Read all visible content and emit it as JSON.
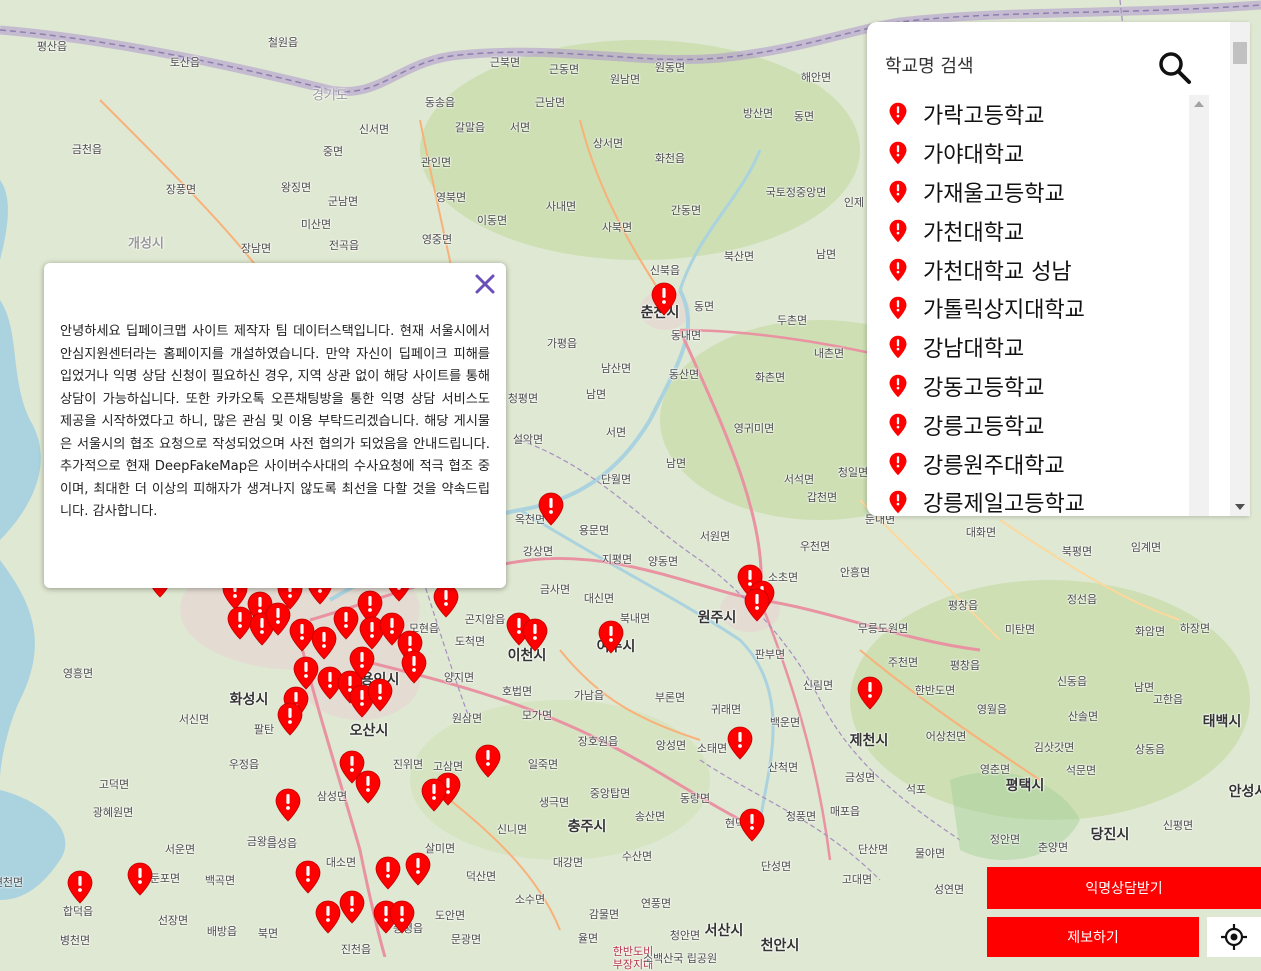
{
  "map": {
    "places": [
      {
        "name": "평산읍"
      },
      {
        "name": "토산읍"
      },
      {
        "name": "철원읍"
      },
      {
        "name": "근북면"
      },
      {
        "name": "근동면"
      },
      {
        "name": "원남면"
      },
      {
        "name": "원동면"
      },
      {
        "name": "해안면"
      },
      {
        "name": "동송읍"
      },
      {
        "name": "근남면"
      },
      {
        "name": "갈말읍"
      },
      {
        "name": "서면"
      },
      {
        "name": "방산면"
      },
      {
        "name": "동면"
      },
      {
        "name": "신서면"
      },
      {
        "name": "중면"
      },
      {
        "name": "상서면"
      },
      {
        "name": "금천읍"
      },
      {
        "name": "관인면"
      },
      {
        "name": "화천읍"
      },
      {
        "name": "왕징면"
      },
      {
        "name": "장풍면"
      },
      {
        "name": "영북면"
      },
      {
        "name": "군남면"
      },
      {
        "name": "국토정중앙면"
      },
      {
        "name": "인제"
      },
      {
        "name": "사내면"
      },
      {
        "name": "간동면"
      },
      {
        "name": "이동면"
      },
      {
        "name": "미산면"
      },
      {
        "name": "사북면"
      },
      {
        "name": "개성시"
      },
      {
        "name": "장남면"
      },
      {
        "name": "전곡읍"
      },
      {
        "name": "영중면"
      },
      {
        "name": "북산면"
      },
      {
        "name": "남면"
      },
      {
        "name": "신북읍"
      },
      {
        "name": "춘천시"
      },
      {
        "name": "동면"
      },
      {
        "name": "두촌면"
      },
      {
        "name": "동내면"
      },
      {
        "name": "가평읍"
      },
      {
        "name": "내촌면"
      },
      {
        "name": "남산면"
      },
      {
        "name": "동산면"
      },
      {
        "name": "화촌면"
      },
      {
        "name": "청평면"
      },
      {
        "name": "남면"
      },
      {
        "name": "설악면"
      },
      {
        "name": "서면"
      },
      {
        "name": "영귀미면"
      },
      {
        "name": "남면"
      },
      {
        "name": "단월면"
      },
      {
        "name": "서석면"
      },
      {
        "name": "청일면"
      },
      {
        "name": "갑천면"
      },
      {
        "name": "옥천면"
      },
      {
        "name": "용문면"
      },
      {
        "name": "강상면"
      },
      {
        "name": "지평면"
      },
      {
        "name": "양동면"
      },
      {
        "name": "서원면"
      },
      {
        "name": "우천면"
      },
      {
        "name": "안흥면"
      },
      {
        "name": "둔내면"
      },
      {
        "name": "대화면"
      },
      {
        "name": "북평면"
      },
      {
        "name": "임계면"
      },
      {
        "name": "금사면"
      },
      {
        "name": "대신면"
      },
      {
        "name": "소초면"
      },
      {
        "name": "평창읍"
      },
      {
        "name": "정선읍"
      },
      {
        "name": "곤지암읍"
      },
      {
        "name": "모현읍"
      },
      {
        "name": "북내면"
      },
      {
        "name": "원주시"
      },
      {
        "name": "무릉도원면"
      },
      {
        "name": "미탄면"
      },
      {
        "name": "화암면"
      },
      {
        "name": "하장면"
      },
      {
        "name": "도척면"
      },
      {
        "name": "이천시"
      },
      {
        "name": "여주시"
      },
      {
        "name": "판부면"
      },
      {
        "name": "주천면"
      },
      {
        "name": "평창읍"
      },
      {
        "name": "영흥면"
      },
      {
        "name": "용인시"
      },
      {
        "name": "양지면"
      },
      {
        "name": "호법면"
      },
      {
        "name": "가남읍"
      },
      {
        "name": "부론면"
      },
      {
        "name": "신림면"
      },
      {
        "name": "한반도면"
      },
      {
        "name": "신동읍"
      },
      {
        "name": "남면"
      },
      {
        "name": "고한읍"
      },
      {
        "name": "화성시"
      },
      {
        "name": "서신면"
      },
      {
        "name": "원삼면"
      },
      {
        "name": "모가면"
      },
      {
        "name": "귀래면"
      },
      {
        "name": "백운면"
      },
      {
        "name": "영월읍"
      },
      {
        "name": "산솔면"
      },
      {
        "name": "태백시"
      },
      {
        "name": "팔탄"
      },
      {
        "name": "오산시"
      },
      {
        "name": "장호원읍"
      },
      {
        "name": "앙성면"
      },
      {
        "name": "소태면"
      },
      {
        "name": "제천시"
      },
      {
        "name": "어상천면"
      },
      {
        "name": "김삿갓면"
      },
      {
        "name": "상동읍"
      },
      {
        "name": "우정읍"
      },
      {
        "name": "진위면"
      },
      {
        "name": "고삼면"
      },
      {
        "name": "일죽면"
      },
      {
        "name": "산척면"
      },
      {
        "name": "금성면"
      },
      {
        "name": "영춘면"
      },
      {
        "name": "석문면"
      },
      {
        "name": "고덕면"
      },
      {
        "name": "삼성면"
      },
      {
        "name": "생극면"
      },
      {
        "name": "중앙탑면"
      },
      {
        "name": "동량면"
      },
      {
        "name": "청풍면"
      },
      {
        "name": "매포읍"
      },
      {
        "name": "석포"
      },
      {
        "name": "평택시"
      },
      {
        "name": "안성시"
      },
      {
        "name": "광혜원면"
      },
      {
        "name": "금왕읍"
      },
      {
        "name": "신니면"
      },
      {
        "name": "충주시"
      },
      {
        "name": "송산면"
      },
      {
        "name": "현덕면"
      },
      {
        "name": "서운면"
      },
      {
        "name": "음성읍"
      },
      {
        "name": "살미면"
      },
      {
        "name": "수산면"
      },
      {
        "name": "단성면"
      },
      {
        "name": "단산면"
      },
      {
        "name": "물야면"
      },
      {
        "name": "춘양면"
      },
      {
        "name": "당진시"
      },
      {
        "name": "신평면"
      },
      {
        "name": "둔포면"
      },
      {
        "name": "백곡면"
      },
      {
        "name": "대소면"
      },
      {
        "name": "덕산면"
      },
      {
        "name": "대강면"
      },
      {
        "name": "고대면"
      },
      {
        "name": "성연면"
      },
      {
        "name": "면천면"
      },
      {
        "name": "합덕읍"
      },
      {
        "name": "선장면"
      },
      {
        "name": "배방읍"
      },
      {
        "name": "북면"
      },
      {
        "name": "진천읍"
      },
      {
        "name": "도안면"
      },
      {
        "name": "소수면"
      },
      {
        "name": "감물면"
      },
      {
        "name": "연풍면"
      },
      {
        "name": "서산시"
      },
      {
        "name": "천안시"
      },
      {
        "name": "병천면"
      },
      {
        "name": "증평읍"
      },
      {
        "name": "문광면"
      },
      {
        "name": "율면"
      },
      {
        "name": "청안면"
      },
      {
        "name": "한반도비 부장지대"
      },
      {
        "name": "소백산국 립공원"
      },
      {
        "name": "경기도"
      },
      {
        "name": "정안면"
      }
    ]
  },
  "markers": {
    "count_label": "",
    "points": []
  },
  "popup": {
    "text": "안녕하세요 딥페이크맵 사이트 제작자 팀 데이터스택입니다. 현재 서울시에서 안심지원센터라는 홈페이지를 개설하였습니다. 만약 자신이 딥페이크 피해를 입었거나 익명 상담 신청이 필요하신 경우, 지역 상관 없이 해당 사이트를 통해 상담이 가능하십니다. 또한 카카오톡 오픈채팅방을 통한 익명 상담 서비스도 제공을 시작하였다고 하니, 많은 관심 및 이용 부탁드리겠습니다. 해당 게시물은 서울시의 협조 요청으로 작성되었으며 사전 협의가 되었음을 안내드립니다. 추가적으로 현재 DeepFakeMap은 사이버수사대의 수사요청에 적극 협조 중이며, 최대한 더 이상의 피해자가 생겨나지 않도록 최선을 다할 것을 약속드립니다. 감사합니다.",
    "close_icon": "close-icon"
  },
  "search": {
    "placeholder": "학교명 검색",
    "icon": "search-icon"
  },
  "schools": [
    "가락고등학교",
    "가야대학교",
    "가재울고등학교",
    "가천대학교",
    "가천대학교 성남",
    "가톨릭상지대학교",
    "강남대학교",
    "강동고등학교",
    "강릉고등학교",
    "강릉원주대학교",
    "강릉제일고등학교"
  ],
  "buttons": {
    "counsel": "익명상담받기",
    "report": "제보하기",
    "locate_icon": "crosshair-icon"
  },
  "colors": {
    "accent": "#ff0000",
    "close": "#6a4fb8",
    "marker": "#ff0000"
  }
}
